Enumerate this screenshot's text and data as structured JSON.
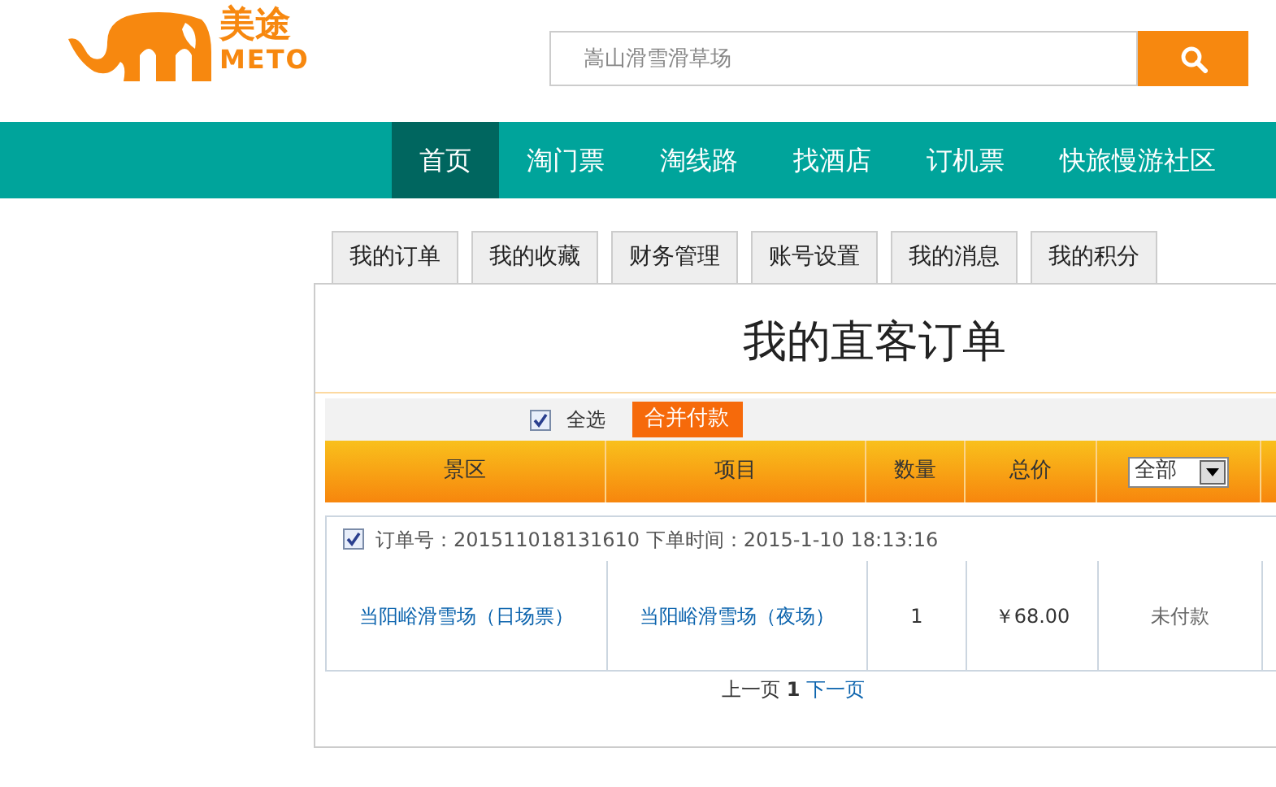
{
  "logo": {
    "name": "美途",
    "latin": "METO"
  },
  "search": {
    "placeholder": "嵩山滑雪滑草场"
  },
  "nav": [
    {
      "label": "首页",
      "selected": true
    },
    {
      "label": "淘门票",
      "selected": false
    },
    {
      "label": "淘线路",
      "selected": false
    },
    {
      "label": "找酒店",
      "selected": false
    },
    {
      "label": "订机票",
      "selected": false
    },
    {
      "label": "快旅慢游社区",
      "selected": false
    }
  ],
  "tabs": [
    "我的订单",
    "我的收藏",
    "财务管理",
    "账号设置",
    "我的消息",
    "我的积分"
  ],
  "title": "我的直客订单",
  "toolbar": {
    "select_all": {
      "label": "全选",
      "checked": true
    },
    "merge_button": "合并付款"
  },
  "table": {
    "columns": [
      "景区",
      "项目",
      "数量",
      "总价"
    ],
    "filter": {
      "value": "全部"
    }
  },
  "orders": [
    {
      "checked": true,
      "info": "订单号：201511018131610 下单时间：2015-1-10 18:13:16",
      "items": [
        {
          "scenic": "当阳峪滑雪场（日场票）",
          "item": "当阳峪滑雪场（夜场）",
          "quantity": "1",
          "price": "￥68.00",
          "status": "未付款"
        }
      ]
    }
  ],
  "pagination": {
    "prev": "上一页",
    "current": "1",
    "next": "下一页"
  }
}
